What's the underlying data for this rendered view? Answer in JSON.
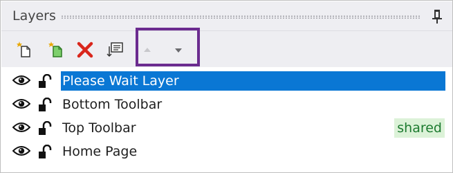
{
  "panel": {
    "title": "Layers"
  },
  "toolbar": {
    "buttons": [
      {
        "icon": "new-layer-icon"
      },
      {
        "icon": "new-shared-layer-icon"
      },
      {
        "icon": "delete-icon"
      },
      {
        "icon": "layer-properties-icon"
      },
      {
        "icon": "move-up-icon",
        "disabled": true
      },
      {
        "icon": "move-down-icon"
      }
    ]
  },
  "layers": [
    {
      "name": "Please Wait Layer",
      "selected": true,
      "badge": ""
    },
    {
      "name": "Bottom Toolbar",
      "selected": false,
      "badge": ""
    },
    {
      "name": "Top Toolbar",
      "selected": false,
      "badge": "shared"
    },
    {
      "name": "Home Page",
      "selected": false,
      "badge": ""
    }
  ],
  "colors": {
    "selection": "#0a77d4",
    "shared_badge_bg": "#dcf2d8",
    "shared_badge_text": "#1c7a2f",
    "highlight_box": "#6b2b8f",
    "delete": "#d9261c"
  }
}
